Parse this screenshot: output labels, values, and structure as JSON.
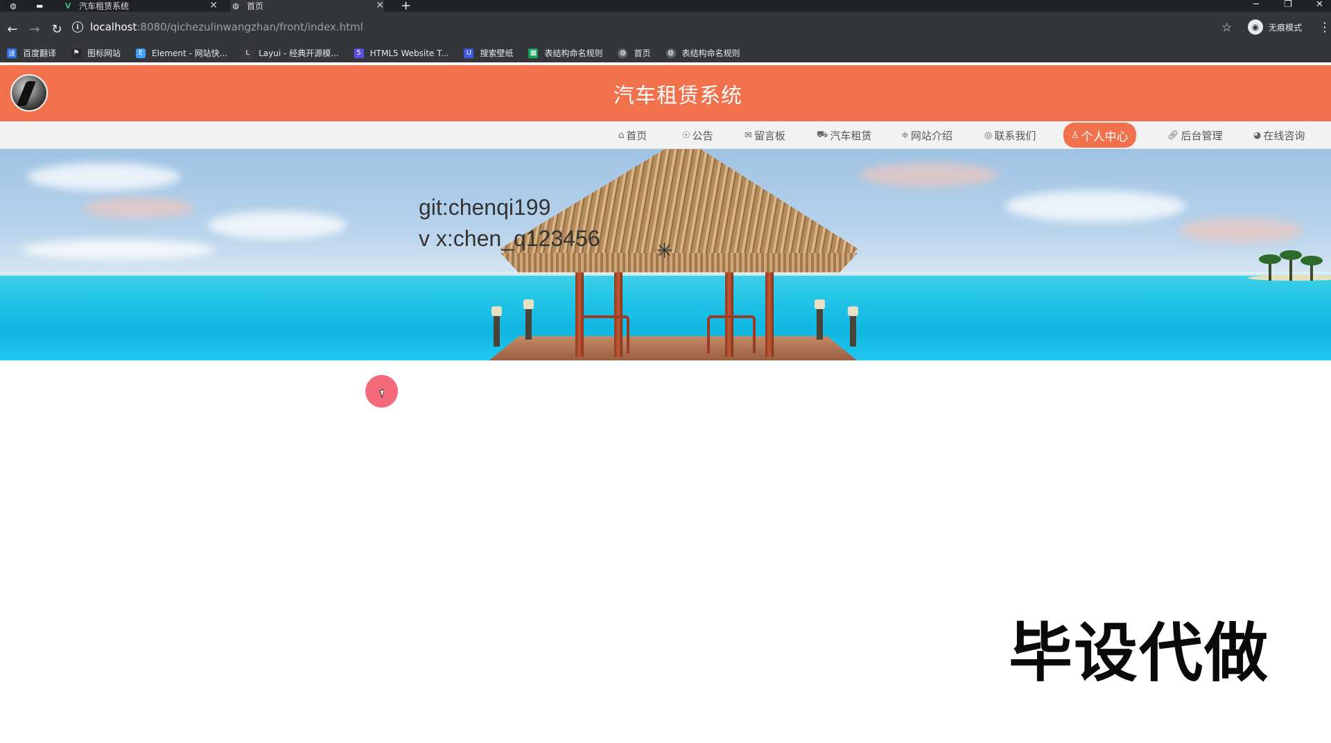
{
  "browser": {
    "tabs": [
      {
        "title": "汽车租赁系统",
        "active": false
      },
      {
        "title": "首页",
        "active": true
      }
    ],
    "url_host": "localhost",
    "url_path": ":8080/qichezulinwangzhan/front/index.html",
    "profile_label": "无痕模式",
    "bookmarks": [
      {
        "label": "百度翻译",
        "icon": "translate-icon",
        "color": "#2f6fe4"
      },
      {
        "label": "图标网站",
        "icon": "flag-icon",
        "color": "#2b2b2b"
      },
      {
        "label": "Element - 网站快...",
        "icon": "element-icon",
        "color": "#409eff"
      },
      {
        "label": "Layui - 经典开源模...",
        "icon": "layui-icon",
        "color": "#3a3a3a"
      },
      {
        "label": "HTML5 Website T...",
        "icon": "html5-icon",
        "color": "#5b4fe0"
      },
      {
        "label": "搜索壁纸",
        "icon": "wallpaper-icon",
        "color": "#3d5be0"
      },
      {
        "label": "表结构命名规则",
        "icon": "sheet-icon",
        "color": "#17a05d"
      },
      {
        "label": "首页",
        "icon": "globe-icon",
        "color": "#5f6368"
      },
      {
        "label": "表结构命名规则",
        "icon": "globe-icon",
        "color": "#5f6368"
      }
    ]
  },
  "site": {
    "title": "汽车租赁系统",
    "accent": "#f0714c",
    "nav": [
      {
        "label": "首页",
        "icon": "home-icon"
      },
      {
        "label": "公告",
        "icon": "notice-icon"
      },
      {
        "label": "留言板",
        "icon": "mail-icon"
      },
      {
        "label": "汽车租赁",
        "icon": "car-icon"
      },
      {
        "label": "网站介绍",
        "icon": "intro-icon"
      },
      {
        "label": "联系我们",
        "icon": "contact-icon"
      },
      {
        "label": "个人中心",
        "icon": "user-icon",
        "active": true
      },
      {
        "label": "后台管理",
        "icon": "link-icon"
      },
      {
        "label": "在线咨询",
        "icon": "chat-icon"
      }
    ],
    "banner_lines": [
      "git:chenqi199",
      "v x:chen_q123456"
    ]
  },
  "overlay": {
    "stamp": "毕设代做"
  }
}
